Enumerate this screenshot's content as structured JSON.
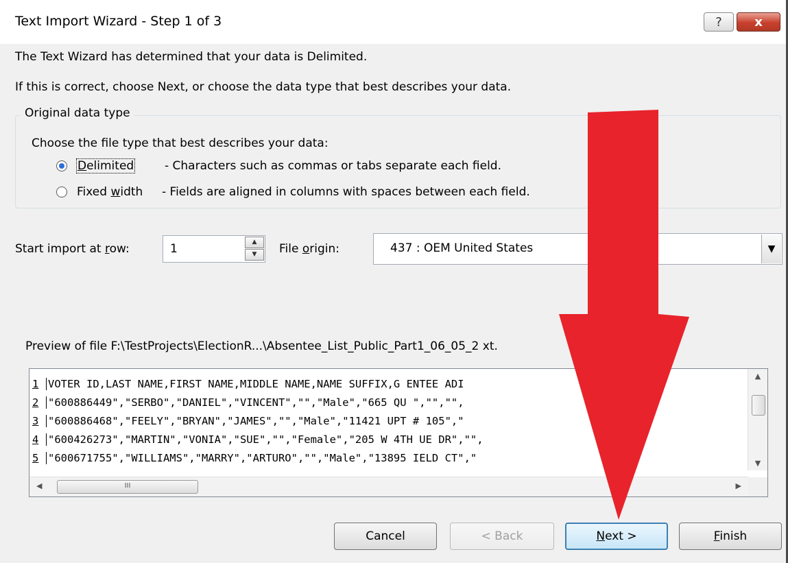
{
  "window": {
    "title": "Text Import Wizard - Step 1 of 3",
    "help_glyph": "?",
    "close_glyph": "x"
  },
  "intro": {
    "line1": "The Text Wizard has determined that your data is Delimited.",
    "line2": "If this is correct, choose Next, or choose the data type that best describes your data."
  },
  "original_data_type": {
    "legend": "Original data type",
    "prompt": "Choose the file type that best describes your data:",
    "options": [
      {
        "label_pre": "",
        "label_key": "D",
        "label_post": "elimited",
        "description": "- Characters such as commas or tabs separate each field.",
        "selected": true
      },
      {
        "label_pre": "Fixed ",
        "label_key": "w",
        "label_post": "idth",
        "description": "- Fields are aligned in columns with spaces between each field.",
        "selected": false
      }
    ]
  },
  "start_row": {
    "label_pre": "Start import at ",
    "label_key": "r",
    "label_post": "ow:",
    "value": "1"
  },
  "file_origin": {
    "label_pre": "File ",
    "label_key": "o",
    "label_post": "rigin:",
    "value": "437 : OEM United States"
  },
  "preview": {
    "label": "Preview of file F:\\TestProjects\\ElectionR...\\Absentee_List_Public_Part1_06_05_2 xt.",
    "rows": [
      {
        "num": "1",
        "text": "VOTER ID,LAST NAME,FIRST NAME,MIDDLE NAME,NAME SUFFIX,G ENTEE ADI"
      },
      {
        "num": "2",
        "text": "\"600886449\",\"SERBO\",\"DANIEL\",\"VINCENT\",\"\",\"Male\",\"665 QU \",\"\",\"\","
      },
      {
        "num": "3",
        "text": "\"600886468\",\"FEELY\",\"BRYAN\",\"JAMES\",\"\",\"Male\",\"11421 UPT # 105\",\""
      },
      {
        "num": "4",
        "text": "\"600426273\",\"MARTIN\",\"VONIA\",\"SUE\",\"\",\"Female\",\"205 W 4TH UE DR\",\"\","
      },
      {
        "num": "5",
        "text": "\"600671755\",\"WILLIAMS\",\"MARRY\",\"ARTURO\",\"\",\"Male\",\"13895 IELD CT\",\""
      }
    ],
    "hscroll_grip": "III"
  },
  "buttons": {
    "cancel": "Cancel",
    "back": "< Back",
    "next_key": "N",
    "next_post": "ext >",
    "finish_key": "F",
    "finish_post": "inish"
  },
  "colors": {
    "annotation_arrow": "#e8232b",
    "window_bg": "#f0f0f0",
    "default_button_border": "#3c7fb1"
  }
}
